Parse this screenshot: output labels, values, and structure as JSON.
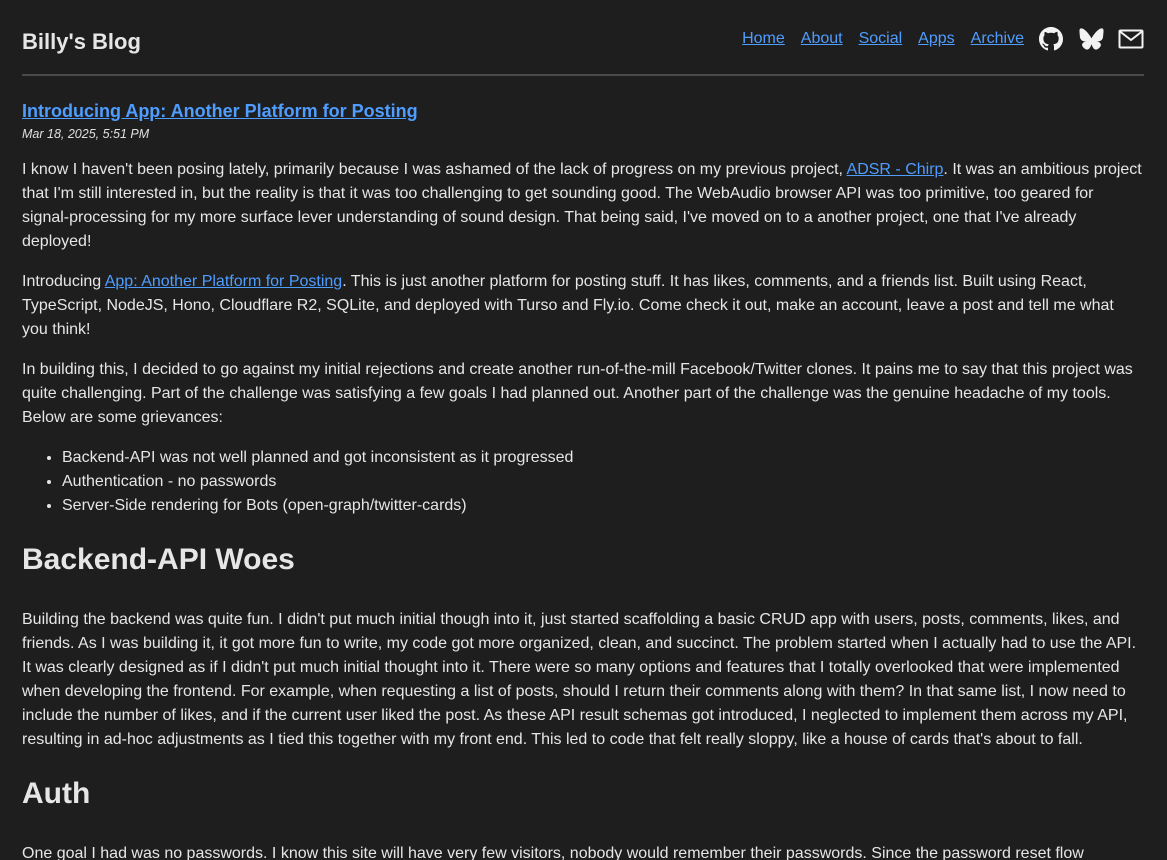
{
  "site": {
    "title": "Billy's Blog"
  },
  "nav": {
    "links": [
      "Home",
      "About",
      "Social",
      "Apps",
      "Archive"
    ],
    "icons": [
      "github-icon",
      "bluesky-icon",
      "mail-icon"
    ]
  },
  "post": {
    "title": "Introducing App: Another Platform for Posting",
    "date": "Mar 18, 2025, 5:51 PM",
    "p1_before": "I know I haven't been posing lately, primarily because I was ashamed of the lack of progress on my previous project, ",
    "p1_link": "ADSR - Chirp",
    "p1_after": ". It was an ambitious project that I'm still interested in, but the reality is that it was too challenging to get sounding good. The WebAudio browser API was too primitive, too geared for signal-processing for my more surface lever understanding of sound design. That being said, I've moved on to a another project, one that I've already deployed!",
    "p2_before": "Introducing ",
    "p2_link": "App: Another Platform for Posting",
    "p2_after": ". This is just another platform for posting stuff. It has likes, comments, and a friends list. Built using React, TypeScript, NodeJS, Hono, Cloudflare R2, SQLite, and deployed with Turso and Fly.io. Come check it out, make an account, leave a post and tell me what you think!",
    "p3": "In building this, I decided to go against my initial rejections and create another run-of-the-mill Facebook/Twitter clones. It pains me to say that this project was quite challenging. Part of the challenge was satisfying a few goals I had planned out. Another part of the challenge was the genuine headache of my tools. Below are some grievances:",
    "list": [
      "Backend-API was not well planned and got inconsistent as it progressed",
      "Authentication - no passwords",
      "Server-Side rendering for Bots (open-graph/twitter-cards)"
    ],
    "h2_backend": "Backend-API Woes",
    "p4": "Building the backend was quite fun. I didn't put much initial though into it, just started scaffolding a basic CRUD app with users, posts, comments, likes, and friends. As I was building it, it got more fun to write, my code got more organized, clean, and succinct. The problem started when I actually had to use the API. It was clearly designed as if I didn't put much initial thought into it. There were so many options and features that I totally overlooked that were implemented when developing the frontend. For example, when requesting a list of posts, should I return their comments along with them? In that same list, I now need to include the number of likes, and if the current user liked the post. As these API result schemas got introduced, I neglected to implement them across my API, resulting in ad-hoc adjustments as I tied this together with my front end. This led to code that felt really sloppy, like a house of cards that's about to fall.",
    "h2_auth": "Auth",
    "p5": "One goal I had was no passwords. I know this site will have very few visitors, nobody would remember their passwords. Since the password reset flow"
  }
}
